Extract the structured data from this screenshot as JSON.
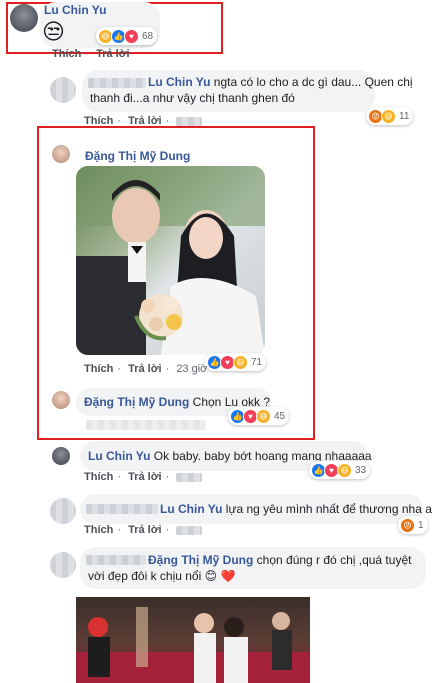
{
  "comments": [
    {
      "name": "Lu Chin Yu",
      "text": "",
      "reactions": {
        "icons": [
          "haha-icon",
          "like-icon",
          "love-icon"
        ],
        "count": "68"
      }
    },
    {
      "name": "Lu Chin Yu",
      "text_line1": "ngta có lo cho a dc gì dau... Quen chị",
      "text_line2": "thanh đi...a như vậy chị thanh ghen đó",
      "reactions": {
        "icons": [
          "angry-icon",
          "haha-icon"
        ],
        "count": "11"
      }
    },
    {
      "name": "Đặng Thị Mỹ Dung",
      "reactions": {
        "icons": [
          "like-icon",
          "love-icon",
          "haha-icon"
        ],
        "count": "71"
      },
      "time": "23 giờ"
    },
    {
      "name": "Đặng Thị Mỹ Dung",
      "text": "Chọn Lu okk ?",
      "reactions": {
        "icons": [
          "like-icon",
          "love-icon",
          "haha-icon"
        ],
        "count": "45"
      }
    },
    {
      "name": "Lu Chin Yu",
      "text": "Ok baby. baby bớt hoang mang nhaaaaa",
      "reactions": {
        "icons": [
          "like-icon",
          "love-icon",
          "haha-icon"
        ],
        "count": "33"
      }
    },
    {
      "name": "Lu Chin Yu",
      "text": "lựa ng yêu mình nhất để thương nha a",
      "reactions": {
        "icons": [
          "angry-icon"
        ],
        "count": "1"
      }
    },
    {
      "name": "Đặng Thị Mỹ Dung",
      "text_line1": "chọn đúng r đó chị ,quá tuyệt",
      "text_line2": "vời đẹp đôi k chịu nổi 😊 ❤️"
    }
  ],
  "actions": {
    "like": "Thích",
    "reply": "Trả lời",
    "dot": "·"
  }
}
